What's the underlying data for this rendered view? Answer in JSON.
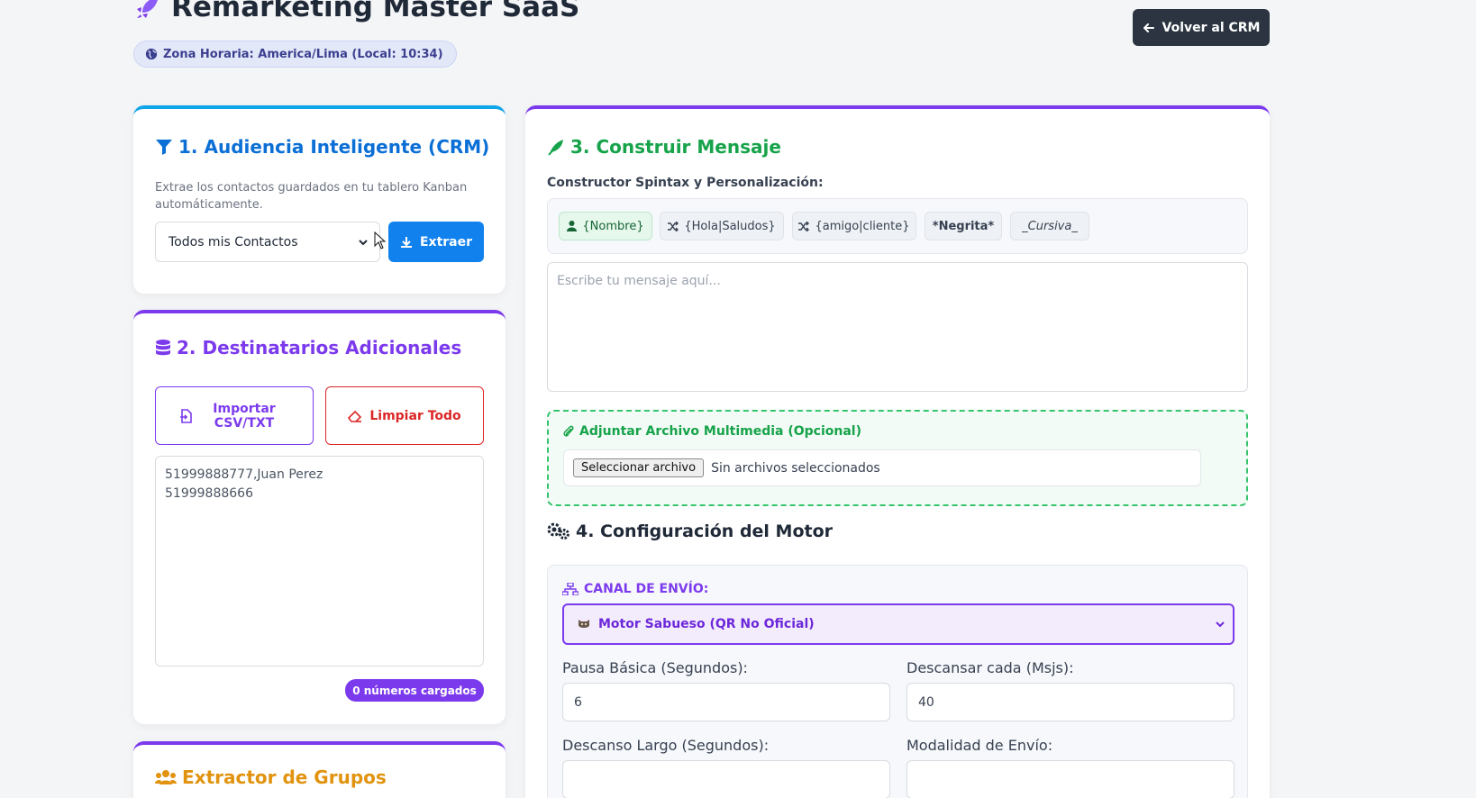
{
  "header": {
    "title": "Remarketing Master SaaS",
    "timezone": "Zona Horaria: America/Lima (Local: 10:34)",
    "back_button": "Volver al CRM"
  },
  "audience": {
    "title": "1. Audiencia Inteligente (CRM)",
    "description": "Extrae los contactos guardados en tu tablero Kanban automáticamente.",
    "select_value": "Todos mis Contactos",
    "extract_button": "Extraer"
  },
  "recipients": {
    "title": "2. Destinatarios Adicionales",
    "import_button": "Importar CSV/TXT",
    "clear_button": "Limpiar Todo",
    "textarea_value": "51999888777,Juan Perez\n51999888666",
    "count_badge": "0 números cargados"
  },
  "groups": {
    "title": "Extractor de Grupos"
  },
  "message": {
    "title": "3. Construir Mensaje",
    "builder_label": "Constructor Spintax y Personalización:",
    "chips": [
      {
        "label": "{Nombre}",
        "icon": "user-icon"
      },
      {
        "label": "{Hola|Saludos}",
        "icon": "shuffle-icon"
      },
      {
        "label": "{amigo|cliente}",
        "icon": "shuffle-icon"
      },
      {
        "label": "*Negrita*",
        "icon": ""
      },
      {
        "label": "_Cursiva_",
        "icon": ""
      }
    ],
    "textarea_placeholder": "Escribe tu mensaje aquí...",
    "attach_title": "Adjuntar Archivo Multimedia (Opcional)",
    "file_button": "Seleccionar archivo",
    "file_status": "Sin archivos seleccionados"
  },
  "engine": {
    "title": "4. Configuración del Motor",
    "channel_label": "CANAL DE ENVÍO:",
    "channel_value": "Motor Sabueso (QR No Oficial)",
    "pause_label": "Pausa Básica (Segundos):",
    "pause_value": "6",
    "rest_every_label": "Descansar cada (Msjs):",
    "rest_every_value": "40",
    "long_rest_label": "Descanso Largo (Segundos):",
    "mode_label": "Modalidad de Envío:"
  },
  "colors": {
    "blue": "#0b6fd6",
    "purple": "#7c3aed",
    "orange": "#e2930e",
    "green": "#16a34a",
    "red": "#dc2626",
    "dark_button": "#2b3440"
  }
}
